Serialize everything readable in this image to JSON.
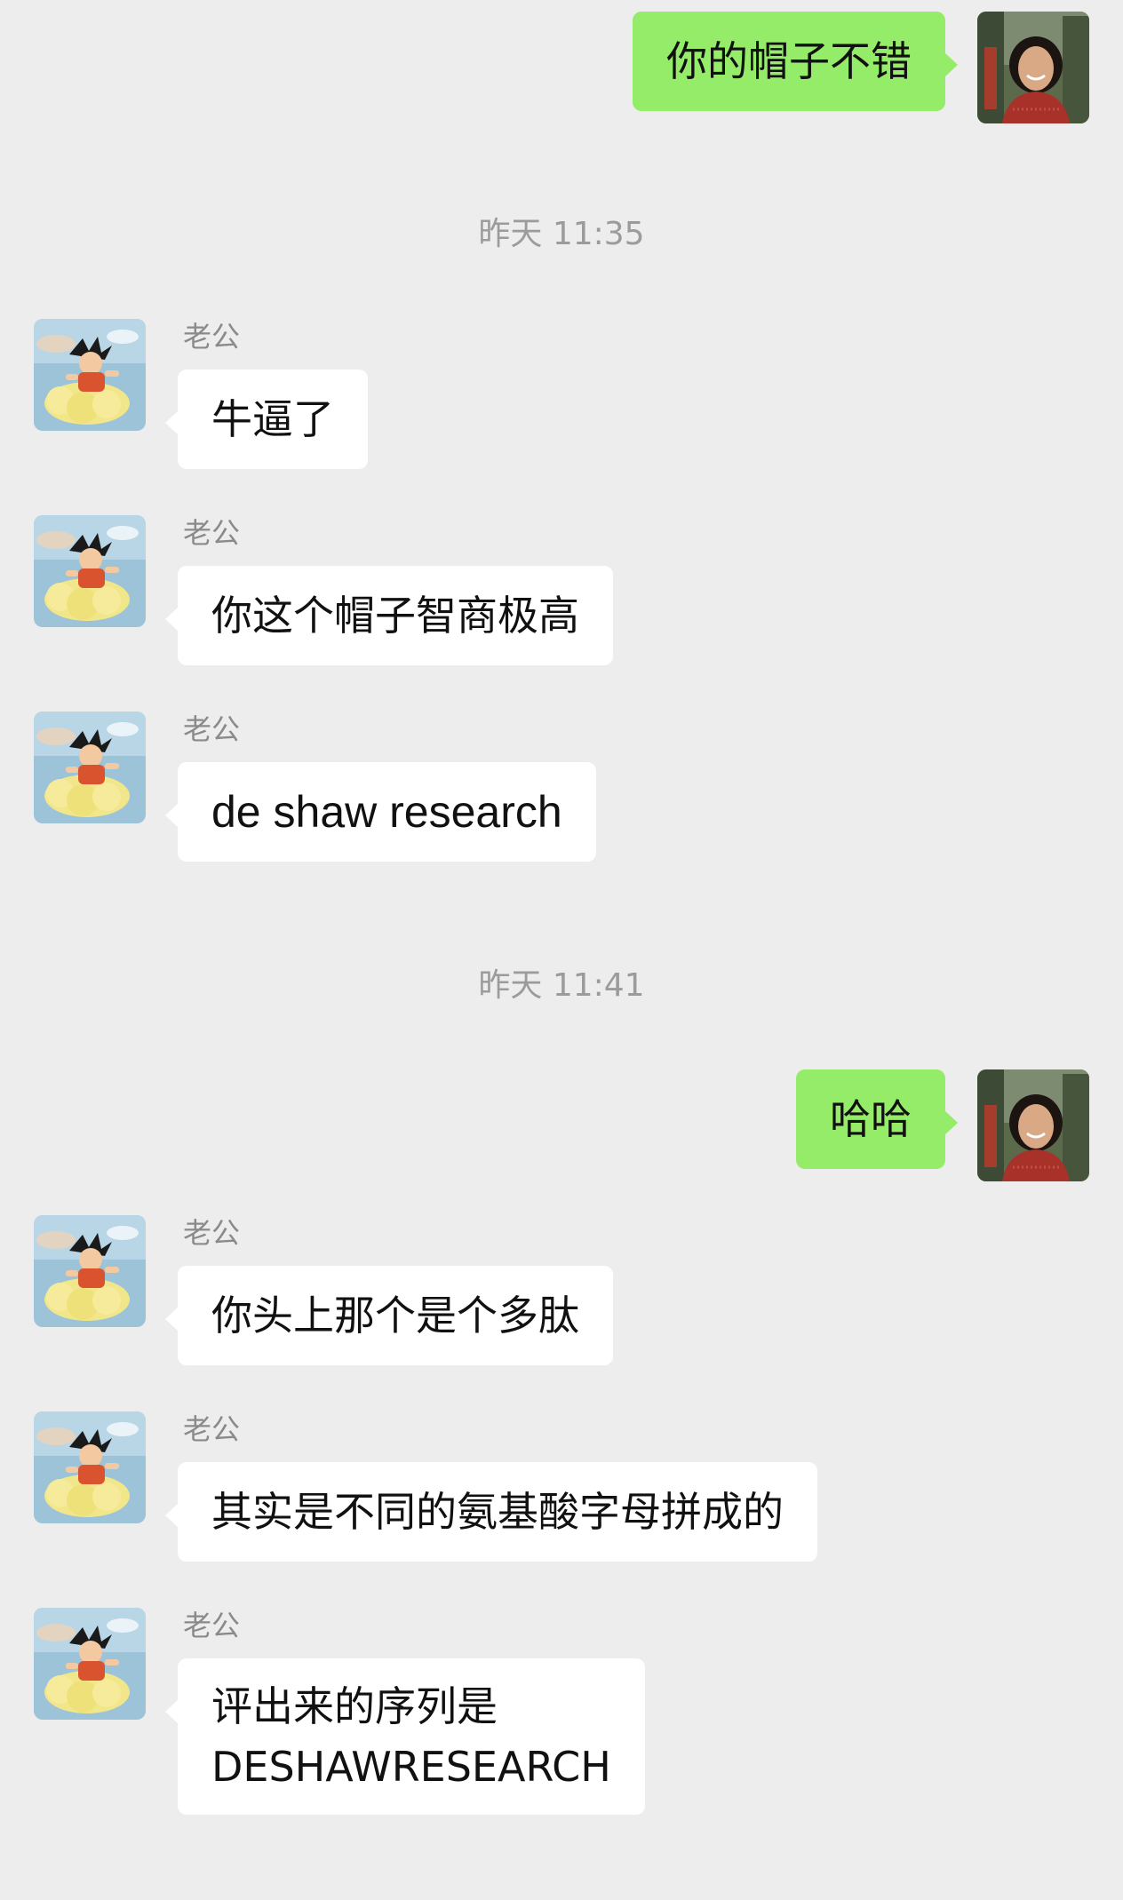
{
  "contact_name": "老公",
  "messages": [
    {
      "side": "right",
      "text": "你的帽子不错"
    },
    {
      "timestamp": "昨天 11:35"
    },
    {
      "side": "left",
      "sender": "老公",
      "text": "牛逼了"
    },
    {
      "side": "left",
      "sender": "老公",
      "text": "你这个帽子智商极高"
    },
    {
      "side": "left",
      "sender": "老公",
      "text": "de shaw research"
    },
    {
      "timestamp": "昨天 11:41"
    },
    {
      "side": "right",
      "text": "哈哈"
    },
    {
      "side": "left",
      "sender": "老公",
      "text": "你头上那个是个多肽"
    },
    {
      "side": "left",
      "sender": "老公",
      "text": "其实是不同的氨基酸字母拼成的"
    },
    {
      "side": "left",
      "sender": "老公",
      "text": "评出来的序列是\nDESHAWRESEARCH"
    }
  ],
  "colors": {
    "background": "#ededed",
    "outgoing_bubble": "#95ec69",
    "incoming_bubble": "#ffffff",
    "timestamp_text": "#9b9b9b",
    "sender_text": "#8a8a8a"
  },
  "icons": {
    "self_avatar": "woman-portrait-avatar",
    "contact_avatar": "cartoon-boy-on-cloud-avatar"
  }
}
